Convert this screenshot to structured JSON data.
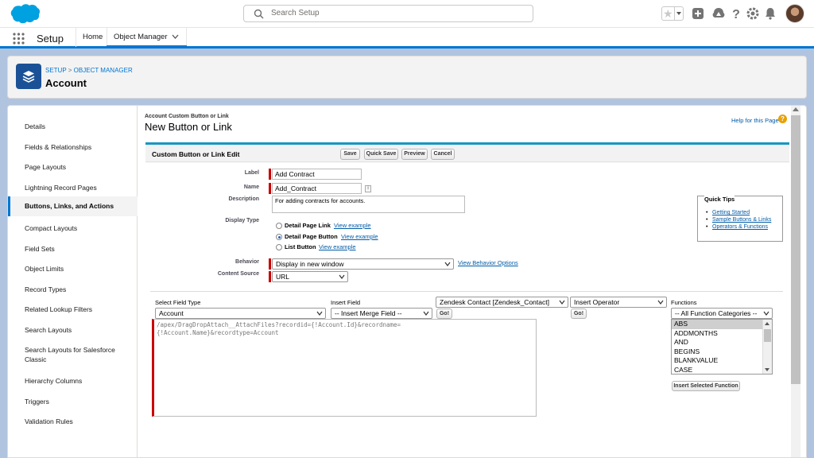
{
  "header": {
    "search_placeholder": "Search Setup",
    "colors": {
      "brand": "#00a1e0",
      "accent": "#0176d3",
      "object_icon": "#1b5297"
    },
    "icons": [
      "salesforce-logo",
      "search-icon",
      "favorite-star-icon",
      "add-icon",
      "trailhead-icon",
      "help-icon",
      "gear-icon",
      "bell-icon",
      "avatar"
    ]
  },
  "nav": {
    "app_name": "Setup",
    "tabs": [
      {
        "label": "Home"
      },
      {
        "label": "Object Manager"
      }
    ]
  },
  "page_header": {
    "crumb_setup": "SETUP",
    "crumb_sep": ">",
    "crumb_object_manager": "OBJECT MANAGER",
    "title": "Account"
  },
  "sidebar": {
    "items": [
      {
        "label": "Details"
      },
      {
        "label": "Fields & Relationships"
      },
      {
        "label": "Page Layouts"
      },
      {
        "label": "Lightning Record Pages"
      },
      {
        "label": "Buttons, Links, and Actions"
      },
      {
        "label": "Compact Layouts"
      },
      {
        "label": "Field Sets"
      },
      {
        "label": "Object Limits"
      },
      {
        "label": "Record Types"
      },
      {
        "label": "Related Lookup Filters"
      },
      {
        "label": "Search Layouts"
      },
      {
        "label": "Search Layouts for Salesforce Classic"
      },
      {
        "label": "Hierarchy Columns"
      },
      {
        "label": "Triggers"
      },
      {
        "label": "Validation Rules"
      }
    ]
  },
  "content": {
    "supertitle": "Account Custom Button or Link",
    "title": "New Button or Link",
    "help_link": "Help for this Page",
    "help_icon_glyph": "?"
  },
  "form": {
    "section_title": "Custom Button or Link Edit",
    "buttons": {
      "save": "Save",
      "quick_save": "Quick Save",
      "preview": "Preview",
      "cancel": "Cancel"
    },
    "labels": {
      "label": "Label",
      "name": "Name",
      "description": "Description",
      "display_type": "Display Type",
      "behavior": "Behavior",
      "content_source": "Content Source"
    },
    "label_value": "Add Contract",
    "name_value": "Add_Contract",
    "info_glyph": "i",
    "description_value": "For adding contracts for accounts.",
    "display_types": [
      {
        "label": "Detail Page Link",
        "link": "View example",
        "selected": false
      },
      {
        "label": "Detail Page Button",
        "link": "View example",
        "selected": true
      },
      {
        "label": "List Button",
        "link": "View example",
        "selected": false
      }
    ],
    "behavior_value": "Display in new window",
    "behavior_link": "View Behavior Options",
    "content_source_value": "URL",
    "quick_tips": {
      "title": "Quick Tips",
      "items": [
        "Getting Started",
        "Sample Buttons & Links",
        "Operators & Functions"
      ]
    },
    "builder": {
      "select_field_type_label": "Select Field Type",
      "select_field_type_value": "Account",
      "insert_field_label": "Insert Field",
      "insert_merge_field_value": "-- Insert Merge Field --",
      "zendesk_value": "Zendesk Contact [Zendesk_Contact]",
      "insert_operator_value": "Insert Operator",
      "functions_label": "Functions",
      "function_categories_value": "-- All Function Categories --",
      "go_label": "Go!",
      "functions": [
        "ABS",
        "ADDMONTHS",
        "AND",
        "BEGINS",
        "BLANKVALUE",
        "CASE"
      ],
      "insert_selected_function": "Insert Selected Function",
      "formula_line1": "/apex/DragDropAttach__AttachFiles?recordid={!Account.Id}&recordname=",
      "formula_line2": "{!Account.Name}&recordtype=Account"
    }
  }
}
